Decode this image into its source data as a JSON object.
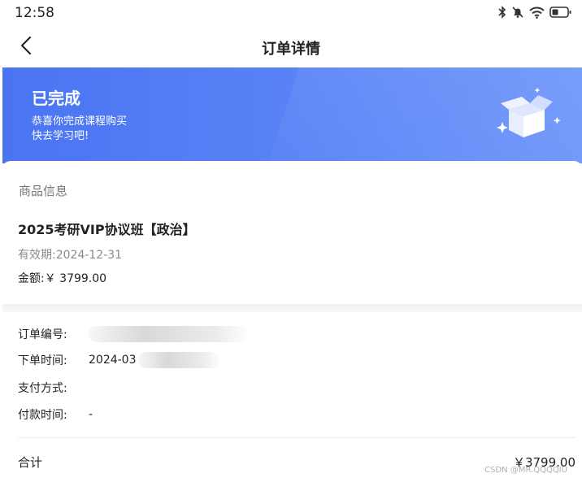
{
  "status_bar": {
    "time": "12:58"
  },
  "nav": {
    "title": "订单详情"
  },
  "hero": {
    "title": "已完成",
    "subtitle_line1": "恭喜你完成课程购买",
    "subtitle_line2": "快去学习吧!",
    "icon": "open-box-icon"
  },
  "product": {
    "section_label": "商品信息",
    "name": "2025考研VIP协议班【政治】",
    "validity": "有效期:2024-12-31",
    "amount": "金额:￥ 3799.00"
  },
  "order": {
    "number_label": "订单编号:",
    "time_label": "下单时间:",
    "time_value": "2024-03",
    "payment_method_label": "支付方式:",
    "payment_time_label": "付款时间:",
    "payment_time_value": "-"
  },
  "total": {
    "label": "合计",
    "value": "￥3799.00"
  },
  "watermark": "CSDN @MR.QQQQIU",
  "colors": {
    "accent": "#4a74f2",
    "text": "#222222",
    "muted": "#8a8a8a"
  }
}
